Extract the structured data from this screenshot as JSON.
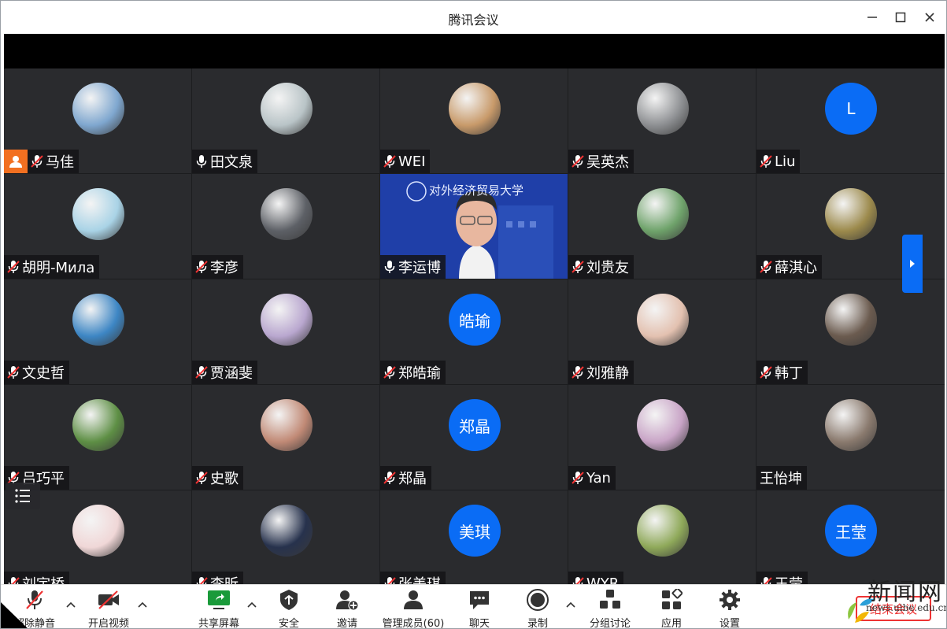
{
  "window": {
    "title": "腾讯会议"
  },
  "participants": [
    {
      "name": "马佳",
      "mic": "muted",
      "host": true,
      "avatar": "photo",
      "avatar_color": "#7fa7cf"
    },
    {
      "name": "田文泉",
      "mic": "on",
      "avatar": "photo",
      "avatar_color": "#b9c4c7"
    },
    {
      "name": "WEI",
      "mic": "muted",
      "avatar": "photo",
      "avatar_color": "#c89a6a"
    },
    {
      "name": "吴英杰",
      "mic": "muted",
      "avatar": "photo",
      "avatar_color": "#8d8f92"
    },
    {
      "name": "Liu",
      "mic": "muted",
      "avatar": "initial",
      "initial": "L"
    },
    {
      "name": "胡明-Мила",
      "mic": "muted",
      "avatar": "photo",
      "avatar_color": "#a9d3e6"
    },
    {
      "name": "李彦",
      "mic": "muted",
      "avatar": "photo",
      "avatar_color": "#5d6066"
    },
    {
      "name": "李运博",
      "mic": "on",
      "avatar": "video",
      "video_text": "对外经济贸易大学"
    },
    {
      "name": "刘贵友",
      "mic": "muted",
      "avatar": "photo",
      "avatar_color": "#6fa36b"
    },
    {
      "name": "薛淇心",
      "mic": "muted",
      "avatar": "photo",
      "avatar_color": "#9c8a4c"
    },
    {
      "name": "文史哲",
      "mic": "muted",
      "avatar": "photo",
      "avatar_color": "#3d86c4"
    },
    {
      "name": "贾涵斐",
      "mic": "muted",
      "avatar": "photo",
      "avatar_color": "#b9a7cf"
    },
    {
      "name": "郑皓瑜",
      "mic": "muted",
      "avatar": "initial",
      "initial": "皓瑜"
    },
    {
      "name": "刘雅静",
      "mic": "muted",
      "avatar": "photo",
      "avatar_color": "#e3c1b0"
    },
    {
      "name": "韩丁",
      "mic": "muted",
      "avatar": "photo",
      "avatar_color": "#6b5b4f"
    },
    {
      "name": "吕巧平",
      "mic": "muted",
      "avatar": "photo",
      "avatar_color": "#5e8f45"
    },
    {
      "name": "史歌",
      "mic": "muted",
      "avatar": "photo",
      "avatar_color": "#c18a76"
    },
    {
      "name": "郑晶",
      "mic": "muted",
      "avatar": "initial",
      "initial": "郑晶"
    },
    {
      "name": "Yan",
      "mic": "muted",
      "avatar": "photo",
      "avatar_color": "#c9a5c7"
    },
    {
      "name": "王怡坤",
      "mic": "none",
      "avatar": "photo",
      "avatar_color": "#8a7a6e"
    },
    {
      "name": "刘宇桥",
      "mic": "muted",
      "avatar": "photo",
      "avatar_color": "#f0d7d7"
    },
    {
      "name": "李昕",
      "mic": "muted",
      "avatar": "photo",
      "avatar_color": "#27324d"
    },
    {
      "name": "张美琪",
      "mic": "muted",
      "avatar": "initial",
      "initial": "美琪"
    },
    {
      "name": "WYR",
      "mic": "muted",
      "avatar": "photo",
      "avatar_color": "#8fa95a"
    },
    {
      "name": "王莹",
      "mic": "muted",
      "avatar": "initial",
      "initial": "王莹"
    }
  ],
  "toolbar": {
    "unmute": "解除静音",
    "video": "开启视频",
    "share": "共享屏幕",
    "security": "安全",
    "invite": "邀请",
    "members": "管理成员(60)",
    "chat": "聊天",
    "record": "录制",
    "breakout": "分组讨论",
    "apps": "应用",
    "settings": "设置",
    "end": "结束会议"
  },
  "watermark": {
    "cn": "新闻网",
    "url": "news.uibe.edu.cn"
  },
  "colors": {
    "accent": "#0a6cf5",
    "host": "#f27021",
    "end": "#e33333"
  }
}
